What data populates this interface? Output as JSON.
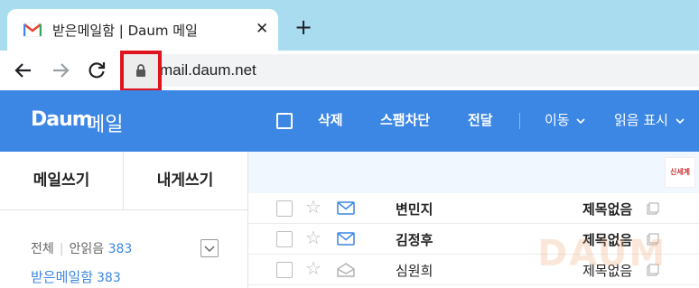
{
  "browser": {
    "tab_title": "받은메일함 | Daum 메일",
    "tab_close": "✕",
    "new_tab": "+",
    "url": "mail.daum.net"
  },
  "header": {
    "logo_brand": "Daum",
    "logo_product": "메일",
    "actions": {
      "delete": "삭제",
      "spam": "스팸차단",
      "forward": "전달",
      "move": "이동",
      "read_mark": "읽음 표시"
    }
  },
  "sidebar": {
    "compose": "메일쓰기",
    "to_self": "내게쓰기",
    "filter_all": "전체",
    "filter_unread": "안읽음",
    "unread_count": "383",
    "inbox_label": "받은메일함",
    "inbox_count": "383"
  },
  "mail_list": {
    "ad_text": "신세계",
    "rows": [
      {
        "sender": "변민지",
        "subject": "제목없음",
        "unread": true
      },
      {
        "sender": "김정후",
        "subject": "제목없음",
        "unread": true
      },
      {
        "sender": "심원희",
        "subject": "제목없음",
        "unread": false
      }
    ]
  },
  "watermark": "DAUM",
  "colors": {
    "daum_blue": "#3c86e4",
    "highlight_red": "#e0141e",
    "tab_strip": "#a8dcee"
  }
}
